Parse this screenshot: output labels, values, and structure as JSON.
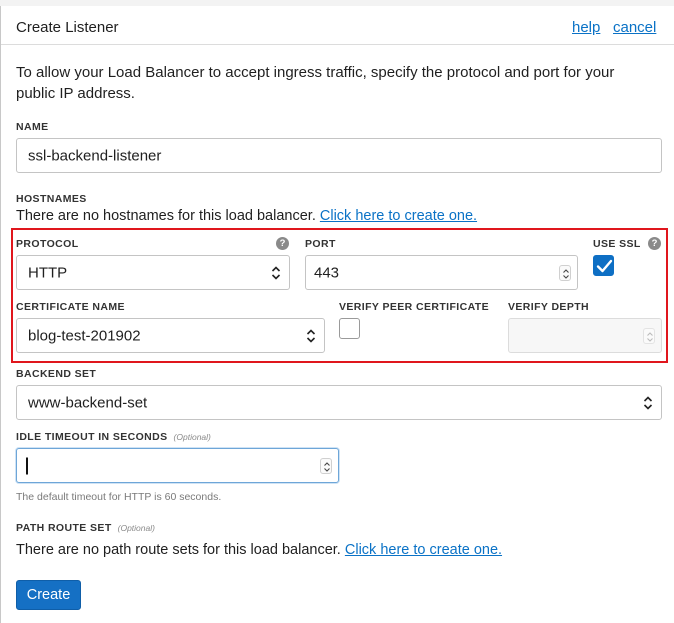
{
  "dialog": {
    "title": "Create Listener",
    "help_link": "help",
    "cancel_link": "cancel",
    "intro": "To allow your Load Balancer to accept ingress traffic, specify the protocol and port for your public IP address."
  },
  "name": {
    "label": "NAME",
    "value": "ssl-backend-listener"
  },
  "hostnames": {
    "label": "HOSTNAMES",
    "text": "There are no hostnames for this load balancer.",
    "link": "Click here to create one."
  },
  "protocol": {
    "label": "PROTOCOL",
    "value": "HTTP"
  },
  "port": {
    "label": "PORT",
    "value": "443"
  },
  "use_ssl": {
    "label": "USE SSL",
    "checked": true
  },
  "certificate": {
    "label": "CERTIFICATE NAME",
    "value": "blog-test-201902"
  },
  "verify_peer": {
    "label": "VERIFY PEER CERTIFICATE",
    "checked": false
  },
  "verify_depth": {
    "label": "VERIFY DEPTH",
    "value": ""
  },
  "backend_set": {
    "label": "BACKEND SET",
    "value": "www-backend-set"
  },
  "idle_timeout": {
    "label": "IDLE TIMEOUT IN SECONDS",
    "optional": "(Optional)",
    "value": "",
    "hint": "The default timeout for HTTP is 60 seconds."
  },
  "path_route_set": {
    "label": "PATH ROUTE SET",
    "optional": "(Optional)",
    "text": "There are no path route sets for this load balancer.",
    "link": "Click here to create one."
  },
  "actions": {
    "create_label": "Create"
  },
  "icons": {
    "help": "?"
  },
  "colors": {
    "link": "#0a72c6",
    "primary_button": "#1570c4",
    "highlight_box": "#e0161d",
    "checkbox_checked": "#0e6fc4"
  }
}
